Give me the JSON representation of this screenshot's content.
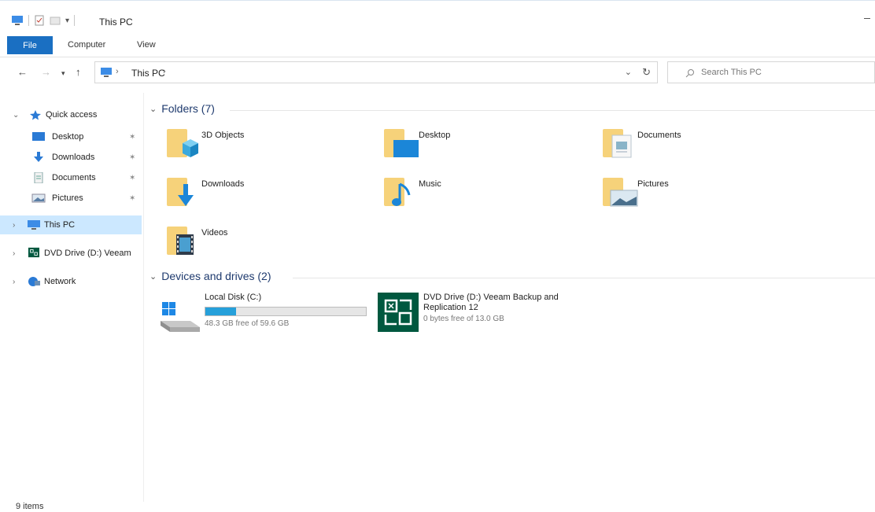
{
  "window": {
    "title": "This PC"
  },
  "ribbon": {
    "tabs": [
      {
        "label": "File"
      },
      {
        "label": "Computer"
      },
      {
        "label": "View"
      }
    ]
  },
  "address_bar": {
    "path": "This PC",
    "search_placeholder": "Search This PC"
  },
  "nav_pane": {
    "quick_access": "Quick access",
    "quick_items": [
      {
        "label": "Desktop",
        "icon": "desktop-icon"
      },
      {
        "label": "Downloads",
        "icon": "downloads-icon"
      },
      {
        "label": "Documents",
        "icon": "documents-icon"
      },
      {
        "label": "Pictures",
        "icon": "pictures-icon"
      }
    ],
    "this_pc": "This PC",
    "dvd_drive": "DVD Drive (D:) Veeam",
    "network": "Network"
  },
  "folders": {
    "header": "Folders (7)",
    "items": [
      {
        "label": "3D Objects",
        "icon": "3d-objects-icon"
      },
      {
        "label": "Desktop",
        "icon": "desktop-icon"
      },
      {
        "label": "Documents",
        "icon": "documents-icon"
      },
      {
        "label": "Downloads",
        "icon": "downloads-icon"
      },
      {
        "label": "Music",
        "icon": "music-icon"
      },
      {
        "label": "Pictures",
        "icon": "pictures-icon"
      },
      {
        "label": "Videos",
        "icon": "videos-icon"
      }
    ]
  },
  "devices": {
    "header": "Devices and drives (2)",
    "local_disk": {
      "name": "Local Disk (C:)",
      "free": "48.3 GB free of 59.6 GB",
      "used_fraction": 0.19
    },
    "dvd": {
      "name_line1": "DVD Drive (D:) Veeam Backup and",
      "name_line2": "Replication 12",
      "free": "0 bytes free of 13.0 GB"
    }
  },
  "status": {
    "items": "9 items"
  },
  "colors": {
    "accent": "#1a6fc2",
    "selection": "#cce8ff",
    "folder": "#f6d27a",
    "veeam": "#00583f",
    "drive_bar": "#26a0da"
  }
}
